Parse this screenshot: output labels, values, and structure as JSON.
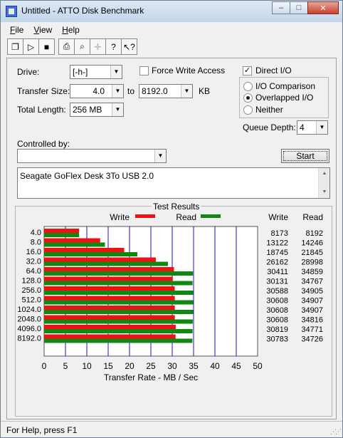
{
  "window": {
    "title": "Untitled - ATTO Disk Benchmark",
    "minimize": "–",
    "maximize": "□",
    "close": "✕"
  },
  "menu": [
    {
      "u": "F",
      "rest": "ile"
    },
    {
      "u": "V",
      "rest": "iew"
    },
    {
      "u": "H",
      "rest": "elp"
    }
  ],
  "toolbar": {
    "new": "❐",
    "open": "▷",
    "save": "■",
    "print": "⎙",
    "preview": "⌕",
    "move": "✛",
    "help": "?",
    "context_help": "↖?"
  },
  "settings": {
    "drive_label": "Drive:",
    "drive_value": "[-h-]",
    "transfer_size_label": "Transfer Size:",
    "transfer_from": "4.0",
    "to_label": "to",
    "transfer_to": "8192.0",
    "kb_label": "KB",
    "total_length_label": "Total Length:",
    "total_length_value": "256 MB",
    "force_write_label": "Force Write Access",
    "direct_io_label": "Direct I/O",
    "io_comparison_label": "I/O Comparison",
    "overlapped_io_label": "Overlapped I/O",
    "neither_label": "Neither",
    "queue_depth_label": "Queue Depth:",
    "queue_depth_value": "4",
    "controlled_by_label": "Controlled by:",
    "controlled_by_value": "",
    "start_label": "Start",
    "description": "Seagate GoFlex Desk 3To USB 2.0"
  },
  "results": {
    "title": "Test Results",
    "write_legend": "Write",
    "read_legend": "Read",
    "write_header": "Write",
    "read_header": "Read"
  },
  "chart_data": {
    "type": "bar",
    "orientation": "horizontal",
    "categories": [
      "4.0",
      "8.0",
      "16.0",
      "32.0",
      "64.0",
      "128.0",
      "256.0",
      "512.0",
      "1024.0",
      "2048.0",
      "4096.0",
      "8192.0"
    ],
    "series": [
      {
        "name": "Write",
        "color": "#ee1111",
        "values": [
          8173,
          13122,
          18745,
          26162,
          30411,
          30131,
          30588,
          30608,
          30608,
          30608,
          30819,
          30783
        ]
      },
      {
        "name": "Read",
        "color": "#118811",
        "values": [
          8192,
          14246,
          21845,
          28998,
          34859,
          34767,
          34905,
          34907,
          34907,
          34816,
          34771,
          34726
        ]
      }
    ],
    "xlabel": "Transfer Rate - MB / Sec",
    "xlim": [
      0,
      50
    ],
    "xticks": [
      0,
      5,
      10,
      15,
      20,
      25,
      30,
      35,
      40,
      45,
      50
    ],
    "grid": true
  },
  "status": {
    "text": "For Help, press F1"
  }
}
